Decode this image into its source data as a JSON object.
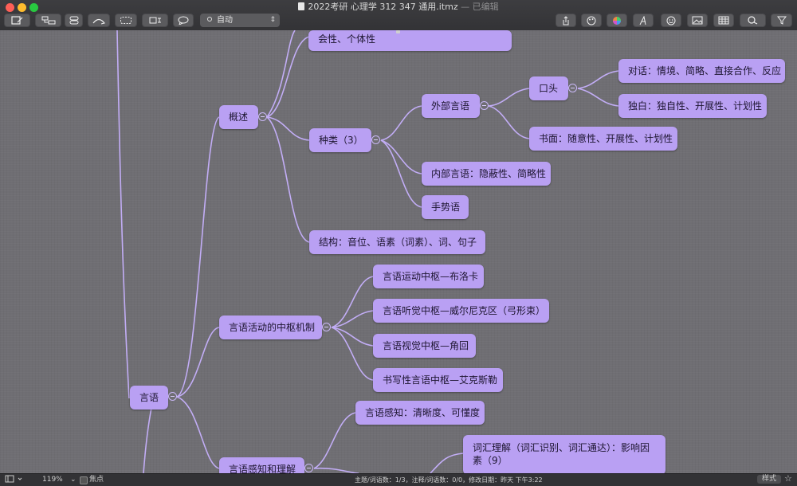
{
  "window": {
    "title": "2022考研 心理学  312 347 通用.itmz",
    "edited_suffix": "— 已编辑"
  },
  "toolbar": {
    "style_value": "自动"
  },
  "mindmap": {
    "root": "言语",
    "overview": "概述",
    "top_partial": "会性、个体性",
    "types": "种类（3）",
    "external": "外部言语",
    "oral": "口头",
    "dialogue": "对话：情境、简略、直接合作、反应",
    "monologue": "独白：独自性、开展性、计划性",
    "written": "书面：随意性、开展性、计划性",
    "internal": "内部言语：隐蔽性、简略性",
    "sign": "手势语",
    "structure": "结构：音位、语素（词素）、词、句子",
    "mechanism": "言语活动的中枢机制",
    "motor_center": "言语运动中枢—布洛卡",
    "auditory_center": "言语听觉中枢—威尔尼克区（弓形束）",
    "visual_center": "言语视觉中枢—角回",
    "writing_center": "书写性言语中枢—艾克斯勒",
    "perception": "言语感知和理解",
    "speech_perception": "言语感知：清晰度、可懂度",
    "lexical": "词汇理解（词汇识别、词汇通达）：影响因素（9）"
  },
  "status": {
    "zoom": "119%",
    "focus_label": "焦点",
    "info": "主题/词语数：1/3，注释/词语数：0/0，修改日期：昨天 下午3:22",
    "style_button": "样式"
  },
  "colors": {
    "node": "#b9a0f3",
    "link": "#c2adf6",
    "canvas": "#6f6e73"
  }
}
